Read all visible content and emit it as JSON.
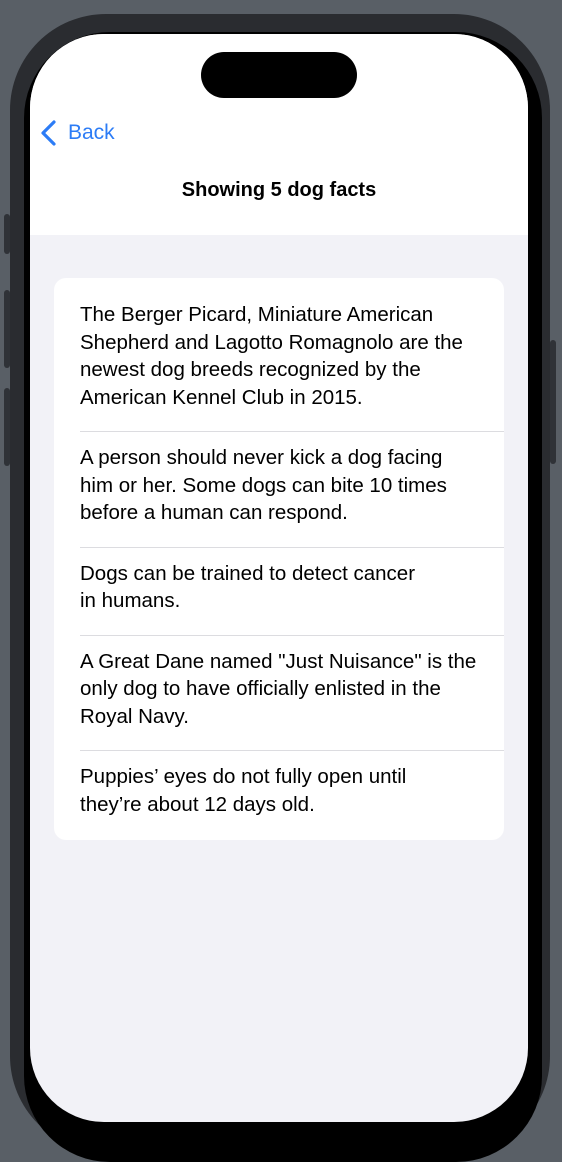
{
  "navigation": {
    "back_label": "Back",
    "title": "Showing 5 dog facts"
  },
  "facts": [
    "The Berger Picard, Miniature American Shepherd and Lagotto Romagnolo are the newest dog breeds recognized by the American Kennel Club in 2015.",
    "A person should never kick a dog facing him or her. Some dogs can bite 10 times before a human can respond.",
    "Dogs can be trained to detect cancer in humans.",
    "A Great Dane named \"Just Nuisance\" is the only dog to have officially enlisted in the Royal Navy.",
    "Puppies’ eyes do not fully open until they’re about 12 days old."
  ],
  "colors": {
    "accent": "#2c7cf6",
    "background": "#f2f2f7",
    "card": "#ffffff"
  },
  "icons": {
    "back": "chevron-left-icon"
  }
}
